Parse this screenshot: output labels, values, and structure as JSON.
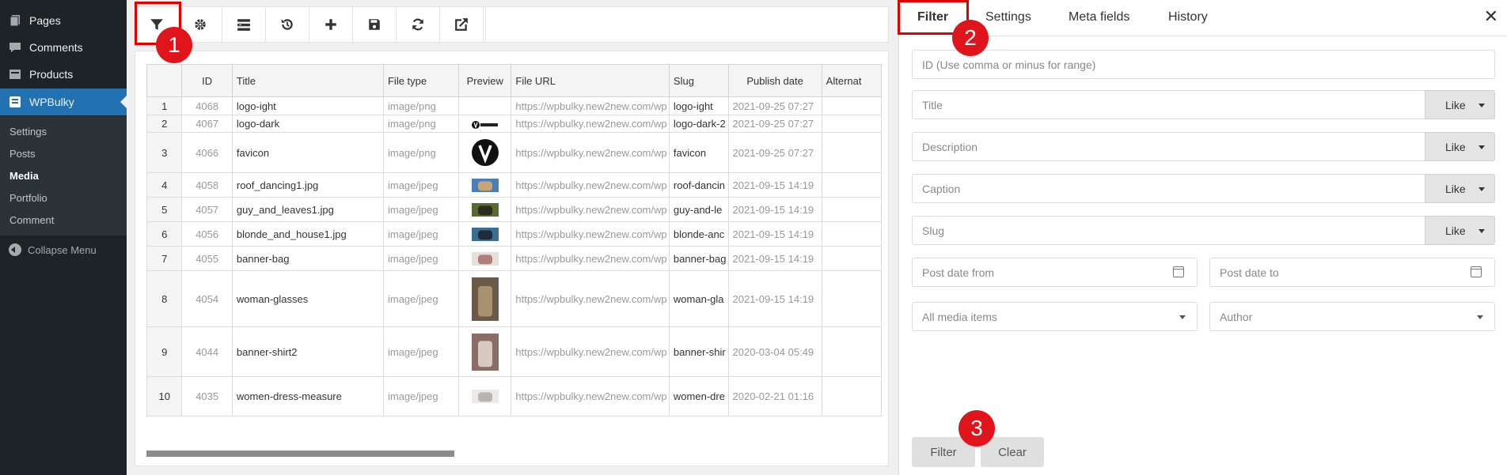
{
  "sidebar": {
    "items": [
      {
        "label": "Pages",
        "icon": "pages-icon"
      },
      {
        "label": "Comments",
        "icon": "comments-icon"
      },
      {
        "label": "Products",
        "icon": "products-icon"
      },
      {
        "label": "WPBulky",
        "icon": "wpbulky-icon",
        "current": true
      }
    ],
    "submenu": [
      "Settings",
      "Posts",
      "Media",
      "Portfolio",
      "Comment"
    ],
    "submenu_current": "Media",
    "collapse_label": "Collapse Menu"
  },
  "toolbar": {
    "buttons": [
      "filter-icon",
      "settings-gear-icon",
      "column-manager-icon",
      "history-icon",
      "add-new-icon",
      "save-icon",
      "refresh-icon",
      "external-link-icon"
    ]
  },
  "markers": [
    "1",
    "2",
    "3"
  ],
  "grid": {
    "columns": [
      "",
      "ID",
      "Title",
      "File type",
      "Preview",
      "File URL",
      "Slug",
      "Publish date",
      "Alternat"
    ],
    "rows": [
      {
        "n": "1",
        "id": "4068",
        "title": "logo-ight",
        "type": "image/png",
        "preview": "none",
        "url": "https://wpbulky.new2new.com/wp",
        "slug": "logo-ight",
        "date": "2021-09-25 07:27"
      },
      {
        "n": "2",
        "id": "4067",
        "title": "logo-dark",
        "type": "image/png",
        "preview": "villatheme-logo",
        "url": "https://wpbulky.new2new.com/wp",
        "slug": "logo-dark-2",
        "date": "2021-09-25 07:27"
      },
      {
        "n": "3",
        "id": "4066",
        "title": "favicon",
        "type": "image/png",
        "preview": "v-circle",
        "url": "https://wpbulky.new2new.com/wp",
        "slug": "favicon",
        "date": "2021-09-25 07:27"
      },
      {
        "n": "4",
        "id": "4058",
        "title": "roof_dancing1.jpg",
        "type": "image/jpeg",
        "preview": "photo",
        "url": "https://wpbulky.new2new.com/wp",
        "slug": "roof-dancin",
        "date": "2021-09-15 14:19"
      },
      {
        "n": "5",
        "id": "4057",
        "title": "guy_and_leaves1.jpg",
        "type": "image/jpeg",
        "preview": "photo",
        "url": "https://wpbulky.new2new.com/wp",
        "slug": "guy-and-le",
        "date": "2021-09-15 14:19"
      },
      {
        "n": "6",
        "id": "4056",
        "title": "blonde_and_house1.jpg",
        "type": "image/jpeg",
        "preview": "photo",
        "url": "https://wpbulky.new2new.com/wp",
        "slug": "blonde-anc",
        "date": "2021-09-15 14:19"
      },
      {
        "n": "7",
        "id": "4055",
        "title": "banner-bag",
        "type": "image/jpeg",
        "preview": "photo",
        "url": "https://wpbulky.new2new.com/wp",
        "slug": "banner-bag",
        "date": "2021-09-15 14:19"
      },
      {
        "n": "8",
        "id": "4054",
        "title": "woman-glasses",
        "type": "image/jpeg",
        "preview": "photo",
        "url": "https://wpbulky.new2new.com/wp",
        "slug": "woman-gla",
        "date": "2021-09-15 14:19"
      },
      {
        "n": "9",
        "id": "4044",
        "title": "banner-shirt2",
        "type": "image/jpeg",
        "preview": "photo",
        "url": "https://wpbulky.new2new.com/wp",
        "slug": "banner-shir",
        "date": "2020-03-04 05:49"
      },
      {
        "n": "10",
        "id": "4035",
        "title": "women-dress-measure",
        "type": "image/jpeg",
        "preview": "photo",
        "url": "https://wpbulky.new2new.com/wp",
        "slug": "women-dre",
        "date": "2020-02-21 01:16"
      }
    ]
  },
  "filter_panel": {
    "tabs": [
      "Filter",
      "Settings",
      "Meta fields",
      "History"
    ],
    "active_tab": "Filter",
    "close_label": "✕",
    "id_placeholder": "ID (Use comma or minus for range)",
    "title_placeholder": "Title",
    "description_placeholder": "Description",
    "caption_placeholder": "Caption",
    "slug_placeholder": "Slug",
    "like_label": "Like",
    "post_date_from": "Post date from",
    "post_date_to": "Post date to",
    "media_select": "All media items",
    "author_select": "Author",
    "filter_button": "Filter",
    "clear_button": "Clear"
  },
  "colors": {
    "accent": "#2271b1",
    "sidebar_bg": "#1d2327",
    "highlight": "#e00000",
    "marker": "#e0141b"
  }
}
